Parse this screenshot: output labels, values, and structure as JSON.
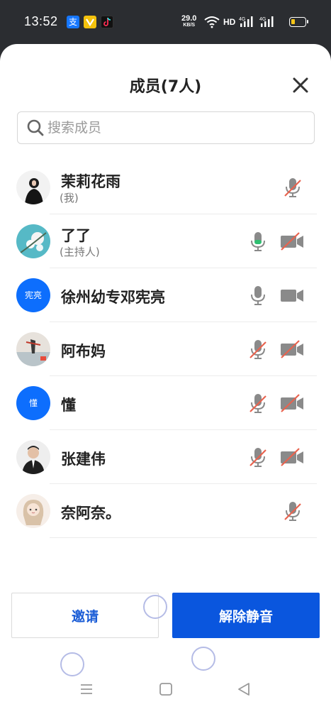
{
  "status_bar": {
    "time": "13:52",
    "app_icons": [
      "alipay-icon",
      "youth-mode-icon",
      "tiktok-icon"
    ],
    "alipay_glyph": "支",
    "net_speed_value": "29.0",
    "net_speed_unit": "KB/S",
    "hd_label": "HD",
    "signal_labels": [
      "4G",
      "4G"
    ],
    "battery_level": 0.2,
    "battery_color": "#f5c518"
  },
  "panel": {
    "title": "成员(7人)",
    "close_icon": "close-icon"
  },
  "search": {
    "placeholder": "搜索成员",
    "value": ""
  },
  "members": [
    {
      "name": "茉莉花雨",
      "role": "(我)",
      "avatar": "photo",
      "mic": "muted",
      "camera": null
    },
    {
      "name": "了了",
      "role": "(主持人)",
      "avatar": "photo",
      "mic": "active",
      "camera": "off"
    },
    {
      "name": "徐州幼专邓宪亮",
      "role": "",
      "avatar_text": "宪亮",
      "mic": "on",
      "camera": "on"
    },
    {
      "name": "阿布妈",
      "role": "",
      "avatar": "photo",
      "mic": "muted",
      "camera": "off"
    },
    {
      "name": "懂",
      "role": "",
      "avatar_text": "懂",
      "mic": "muted",
      "camera": "off"
    },
    {
      "name": "张建伟",
      "role": "",
      "avatar": "photo",
      "mic": "muted",
      "camera": "off"
    },
    {
      "name": "奈阿奈。",
      "role": "",
      "avatar": "photo",
      "mic": "muted",
      "camera": null
    }
  ],
  "colors": {
    "primary": "#0a56de",
    "avatar_blue": "#0d6efd",
    "muted_slash": "#e8634f",
    "mic_active": "#2fbf71",
    "icon_gray": "#8a8a8a"
  },
  "actions": {
    "invite_label": "邀请",
    "unmute_label": "解除静音"
  },
  "nav": {
    "menu_icon": "menu-icon",
    "home_icon": "home-icon",
    "back_icon": "back-icon"
  }
}
